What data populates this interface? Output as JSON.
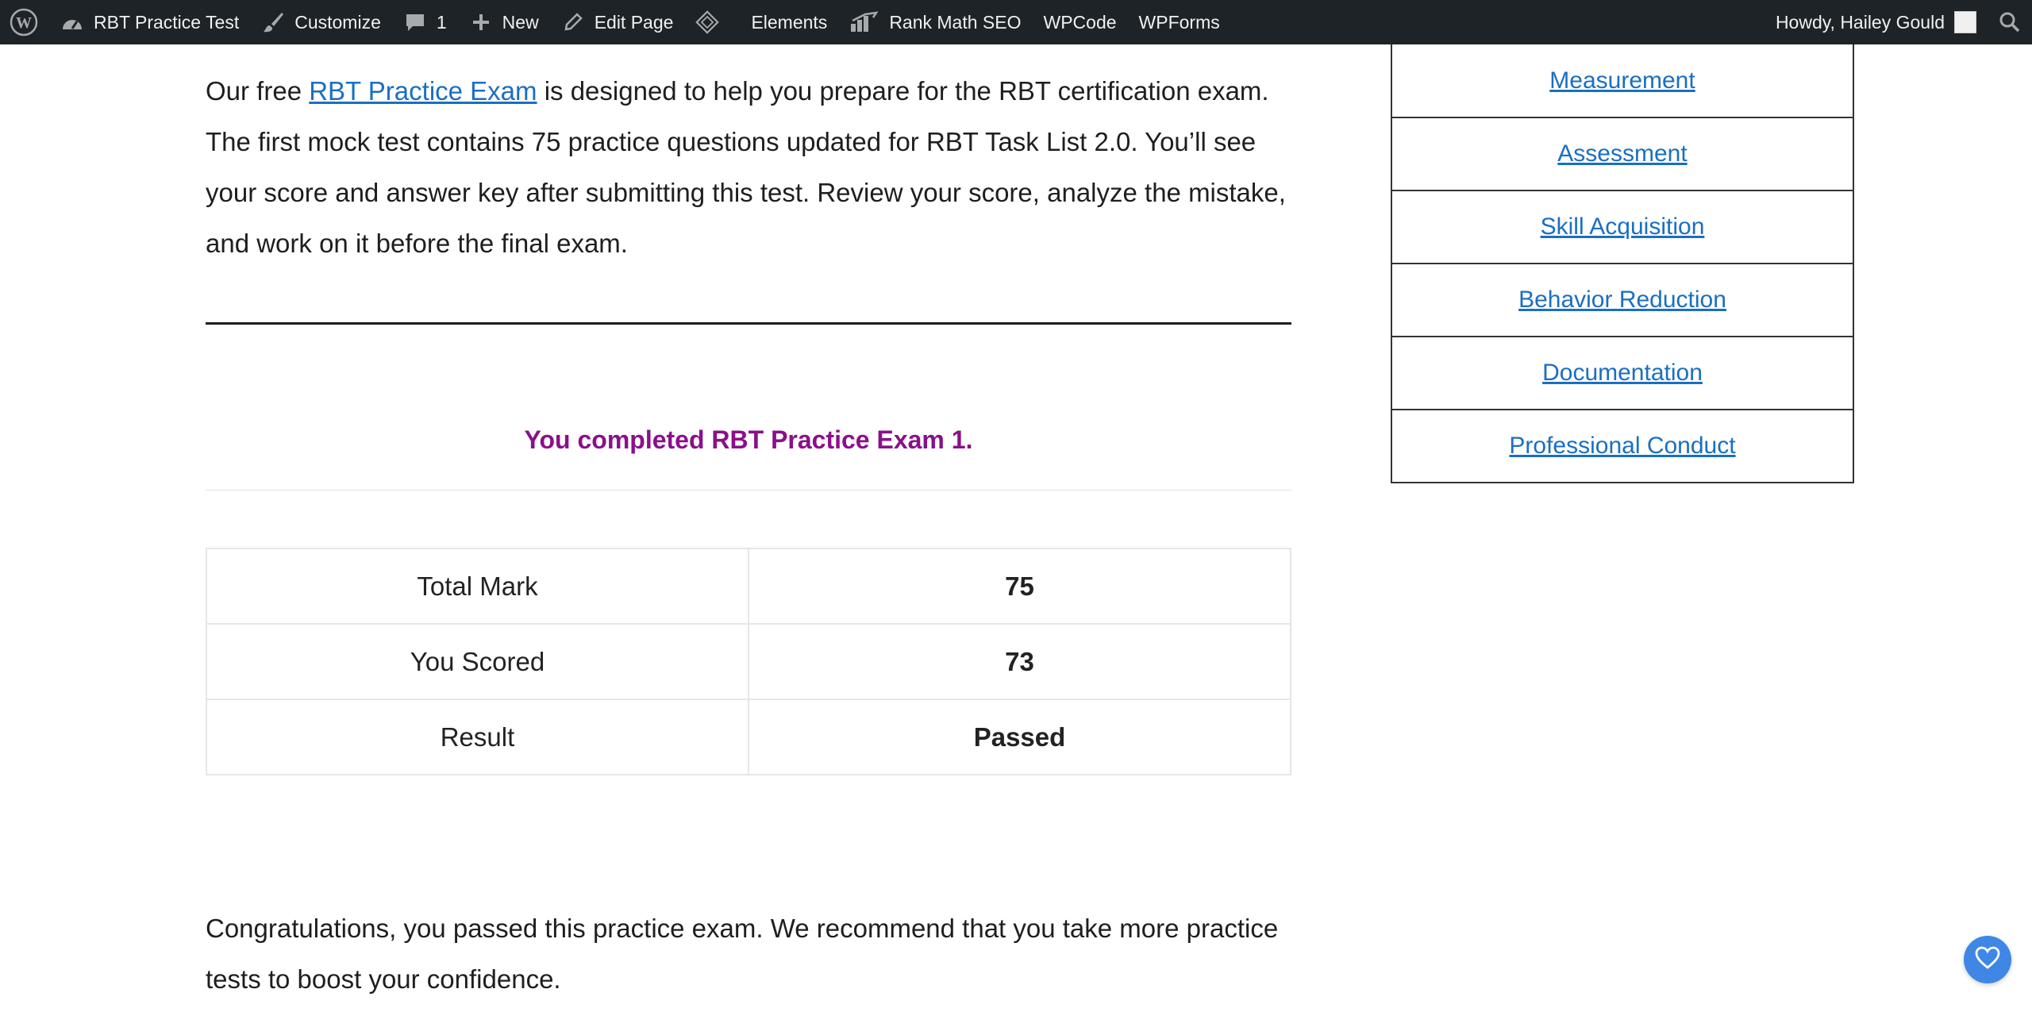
{
  "adminbar": {
    "site_name": "RBT Practice Test",
    "customize": "Customize",
    "comments_count": "1",
    "new": "New",
    "edit_page": "Edit Page",
    "elements": "Elements",
    "rank_math": "Rank Math SEO",
    "wpcode": "WPCode",
    "wpforms": "WPForms",
    "howdy": "Howdy, Hailey Gould"
  },
  "intro": {
    "before_link": "Our free ",
    "link_text": "RBT Practice Exam",
    "after_link": " is designed to help you prepare for the RBT certification exam. The first mock test contains 75 practice questions updated for RBT Task List 2.0. You’ll see your score and answer key after submitting this test. Review your score, analyze the mistake, and work on it before the final exam."
  },
  "completed_message": "You completed RBT Practice Exam 1.",
  "results": [
    {
      "label": "Total Mark",
      "value": "75"
    },
    {
      "label": "You Scored",
      "value": "73"
    },
    {
      "label": "Result",
      "value": "Passed"
    }
  ],
  "congrats": "Congratulations, you passed this practice exam. We recommend that you take more practice tests to boost your confidence.",
  "sidebar": {
    "items": [
      {
        "label": "Measurement"
      },
      {
        "label": "Assessment"
      },
      {
        "label": "Skill Acquisition"
      },
      {
        "label": "Behavior Reduction"
      },
      {
        "label": "Documentation"
      },
      {
        "label": "Professional Conduct"
      }
    ]
  },
  "colors": {
    "adminbar_bg": "#1d2327",
    "link": "#1a6fc1",
    "completed": "#8b0f8b",
    "fab": "#3f87e5"
  }
}
